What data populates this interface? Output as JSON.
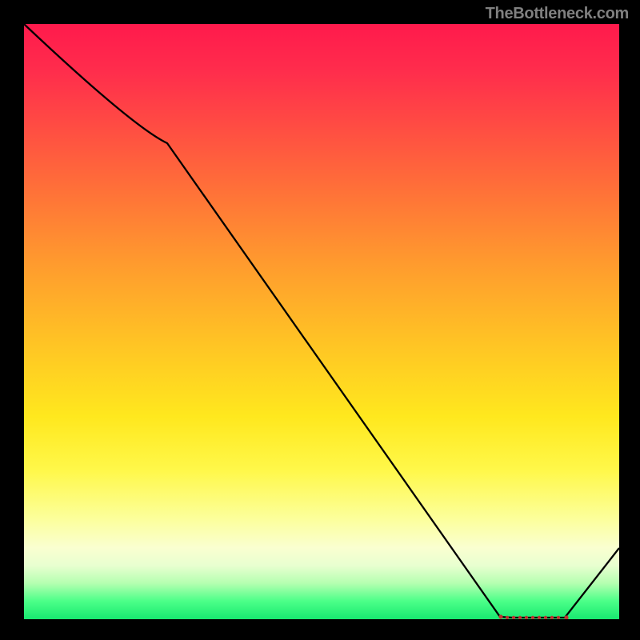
{
  "watermark": "TheBottleneck.com",
  "chart_data": {
    "type": "line",
    "title": "",
    "xlabel": "",
    "ylabel": "",
    "x": [
      0.0,
      0.24,
      0.8,
      0.82,
      0.9,
      1.0
    ],
    "values": [
      1.0,
      0.8,
      0.0,
      0.0,
      0.0,
      0.12
    ],
    "xlim": [
      0,
      1
    ],
    "ylim": [
      0,
      1
    ],
    "annotations": [
      {
        "kind": "dot-cluster",
        "x_start": 0.8,
        "x_end": 0.91,
        "y": 0.0
      }
    ]
  }
}
